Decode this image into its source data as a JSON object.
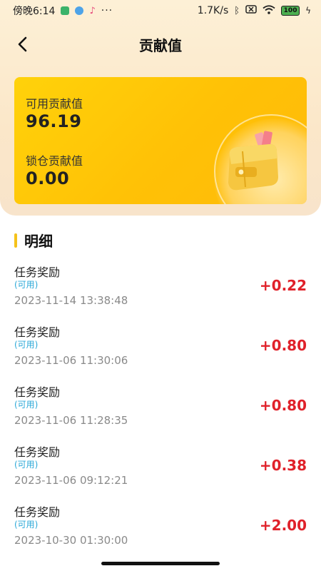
{
  "status_bar": {
    "time": "傍晚6:14",
    "network_speed": "1.7K/s",
    "battery": "100",
    "icons": [
      "shield-icon",
      "cloud-icon",
      "music-icon",
      "more-dots-icon",
      "bluetooth-icon",
      "no-sim-icon",
      "wifi-icon",
      "battery-icon",
      "charging-icon"
    ]
  },
  "header": {
    "title": "贡献值",
    "back_icon": "chevron-left-icon"
  },
  "card": {
    "available_label": "可用贡献值",
    "available_value": "96.19",
    "locked_label": "锁仓贡献值",
    "locked_value": "0.00",
    "illustration": "wallet-icon",
    "colors": {
      "gradient_start": "#ffd20a",
      "gradient_end": "#ffbb0a"
    }
  },
  "section": {
    "title": "明细",
    "accent": "#f5c21a"
  },
  "records": [
    {
      "title": "任务奖励",
      "tag": "(可用)",
      "time": "2023-11-14 13:38:48",
      "amount": "+0.22"
    },
    {
      "title": "任务奖励",
      "tag": "(可用)",
      "time": "2023-11-06 11:30:06",
      "amount": "+0.80"
    },
    {
      "title": "任务奖励",
      "tag": "(可用)",
      "time": "2023-11-06 11:28:35",
      "amount": "+0.80"
    },
    {
      "title": "任务奖励",
      "tag": "(可用)",
      "time": "2023-11-06 09:12:21",
      "amount": "+0.38"
    },
    {
      "title": "任务奖励",
      "tag": "(可用)",
      "time": "2023-10-30 01:30:00",
      "amount": "+2.00"
    }
  ],
  "colors": {
    "amount_positive": "#e0212a",
    "tag": "#2aa8d8",
    "timestamp": "#8a8a8a"
  }
}
